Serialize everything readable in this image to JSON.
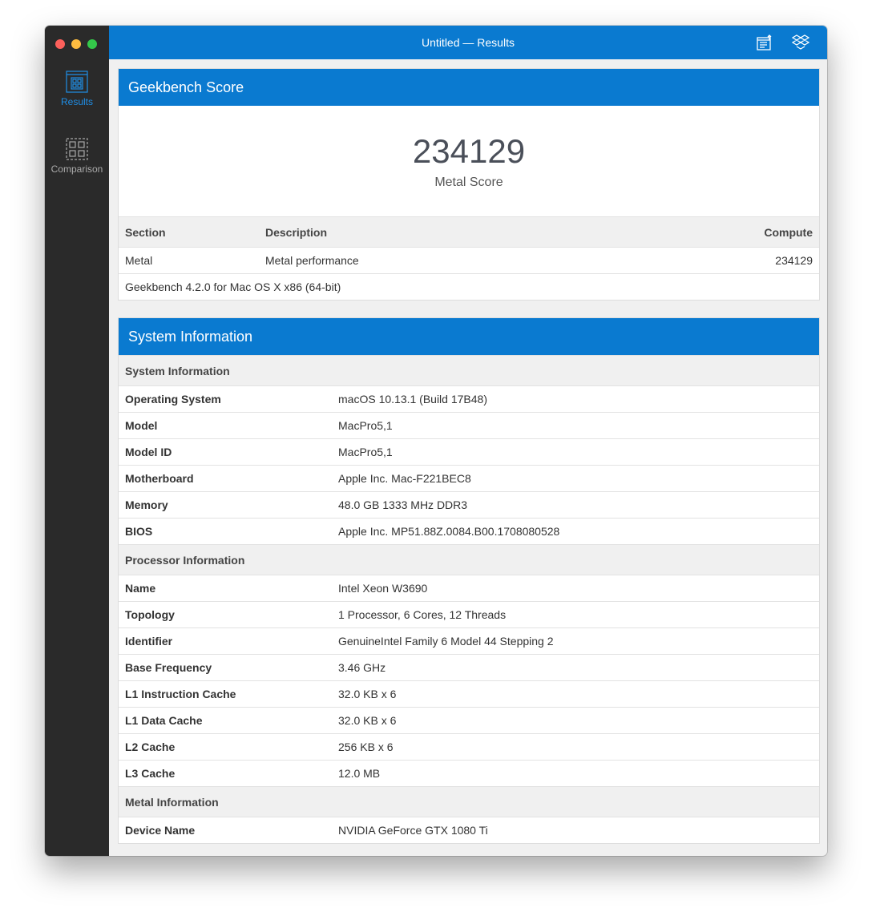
{
  "window": {
    "title": "Untitled — Results"
  },
  "sidebar": {
    "items": [
      {
        "label": "Results",
        "icon": "results-icon",
        "active": true
      },
      {
        "label": "Comparison",
        "icon": "comparison-icon",
        "active": false
      }
    ]
  },
  "toolbar": {
    "icons": [
      "share-icon",
      "dropbox-icon"
    ]
  },
  "score": {
    "title": "Geekbench Score",
    "value": "234129",
    "label": "Metal Score",
    "headers": [
      "Section",
      "Description",
      "Compute"
    ],
    "rows": [
      [
        "Metal",
        "Metal performance",
        "234129"
      ]
    ],
    "footer": "Geekbench 4.2.0 for Mac OS X x86 (64-bit)"
  },
  "system": {
    "title": "System Information",
    "groups": [
      {
        "title": "System Information",
        "rows": [
          [
            "Operating System",
            "macOS 10.13.1 (Build 17B48)"
          ],
          [
            "Model",
            "MacPro5,1"
          ],
          [
            "Model ID",
            "MacPro5,1"
          ],
          [
            "Motherboard",
            "Apple Inc. Mac-F221BEC8"
          ],
          [
            "Memory",
            "48.0 GB 1333 MHz DDR3"
          ],
          [
            "BIOS",
            "Apple Inc. MP51.88Z.0084.B00.1708080528"
          ]
        ]
      },
      {
        "title": "Processor Information",
        "rows": [
          [
            "Name",
            "Intel Xeon W3690"
          ],
          [
            "Topology",
            "1 Processor, 6 Cores, 12 Threads"
          ],
          [
            "Identifier",
            "GenuineIntel Family 6 Model 44 Stepping 2"
          ],
          [
            "Base Frequency",
            "3.46 GHz"
          ],
          [
            "L1 Instruction Cache",
            "32.0 KB x 6"
          ],
          [
            "L1 Data Cache",
            "32.0 KB x 6"
          ],
          [
            "L2 Cache",
            "256 KB x 6"
          ],
          [
            "L3 Cache",
            "12.0 MB"
          ]
        ]
      },
      {
        "title": "Metal Information",
        "rows": [
          [
            "Device Name",
            "NVIDIA GeForce GTX 1080 Ti"
          ]
        ]
      }
    ]
  },
  "colors": {
    "accent": "#0a7ad0",
    "sidebar": "#2a2a2a"
  }
}
